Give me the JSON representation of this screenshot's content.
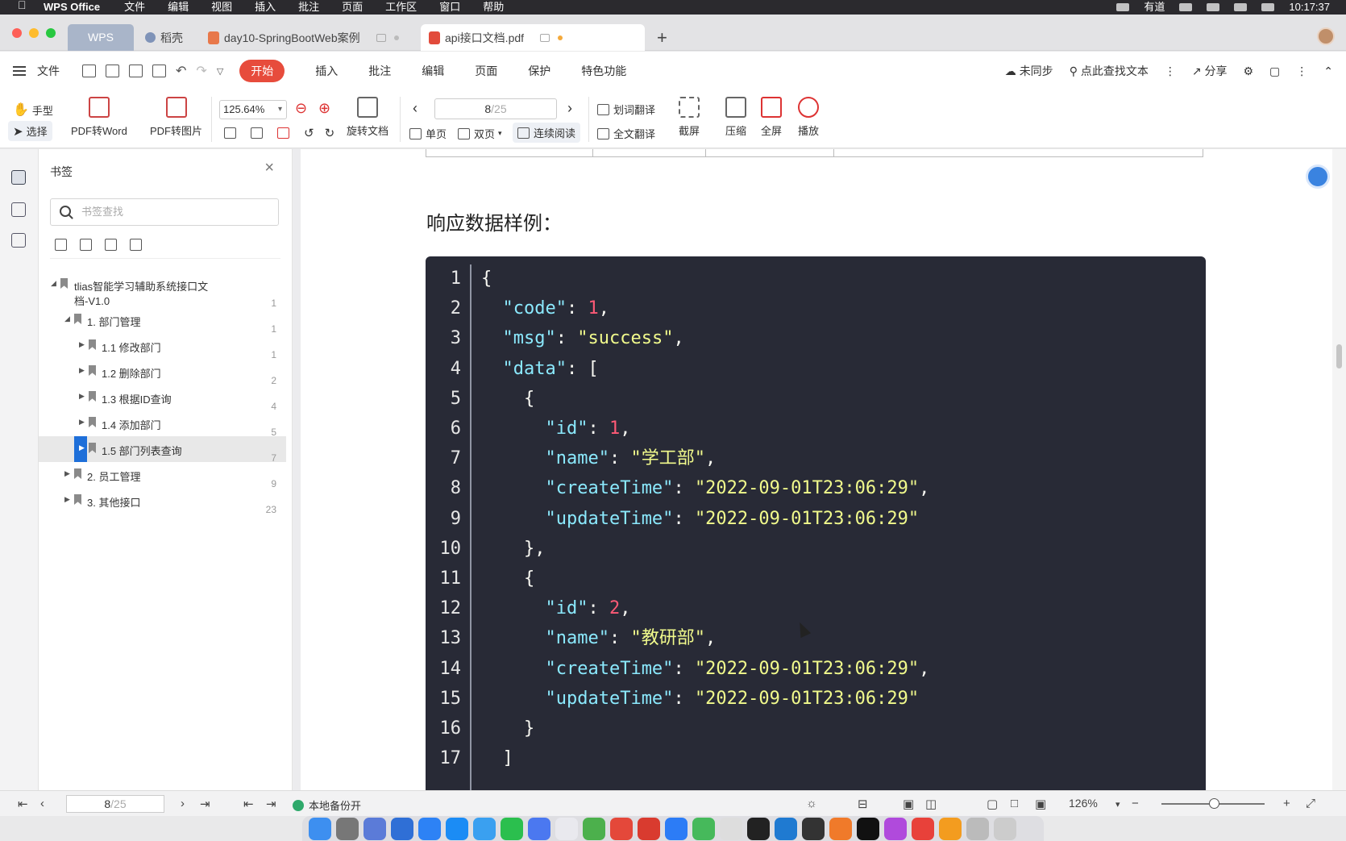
{
  "menubar": {
    "app_name": "WPS Office",
    "items": [
      "文件",
      "编辑",
      "视图",
      "插入",
      "批注",
      "页面",
      "工作区",
      "窗口",
      "帮助"
    ],
    "status_app": "有道",
    "time": "10:17:37"
  },
  "tabs": {
    "home_label": "WPS",
    "items": [
      {
        "label": "稻壳",
        "icon": "daoke-icon"
      },
      {
        "label": "day10-SpringBootWeb案例",
        "icon": "ppt-file-icon"
      },
      {
        "label": "api接口文档.pdf",
        "icon": "pdf-file-icon"
      }
    ],
    "new_tab": "+"
  },
  "menu": {
    "file": "文件",
    "start": "开始",
    "items": [
      "插入",
      "批注",
      "编辑",
      "页面",
      "保护",
      "特色功能"
    ],
    "sync": "未同步",
    "find": "点此查找文本",
    "share": "分享"
  },
  "toolbar": {
    "hand": "手型",
    "select": "选择",
    "pdf_to_word": "PDF转Word",
    "pdf_to_image": "PDF转图片",
    "zoom": "125.64%",
    "rotate_doc": "旋转文档",
    "page_current": "8",
    "page_total": "/25",
    "single_page": "单页",
    "double_page": "双页",
    "continuous": "连续阅读",
    "word_translate": "划词翻译",
    "full_translate": "全文翻译",
    "screenshot": "截屏",
    "compress": "压缩",
    "fullscreen": "全屏",
    "play": "播放"
  },
  "bookmarks": {
    "title": "书签",
    "search_placeholder": "书签查找",
    "items": [
      {
        "label": "tlias智能学习辅助系统接口文",
        "label2": "档-V1.0",
        "page": "1",
        "level": 0,
        "expanded": true
      },
      {
        "label": "1. 部门管理",
        "page": "1",
        "level": 1,
        "expanded": true
      },
      {
        "label": "1.1 修改部门",
        "page": "1",
        "level": 2
      },
      {
        "label": "1.2 删除部门",
        "page": "2",
        "level": 2
      },
      {
        "label": "1.3 根据ID查询",
        "page": "4",
        "level": 2
      },
      {
        "label": "1.4 添加部门",
        "page": "5",
        "level": 2
      },
      {
        "label": "1.5 部门列表查询",
        "page": "7",
        "level": 2,
        "selected": true
      },
      {
        "label": "2. 员工管理",
        "page": "9",
        "level": 1
      },
      {
        "label": "3. 其他接口",
        "page": "23",
        "level": 1
      }
    ]
  },
  "document": {
    "heading": "响应数据样例：",
    "code_lines": [
      {
        "n": "1",
        "t": "{"
      },
      {
        "n": "2",
        "t": "  \"code\": 1,"
      },
      {
        "n": "3",
        "t": "  \"msg\": \"success\","
      },
      {
        "n": "4",
        "t": "  \"data\": ["
      },
      {
        "n": "5",
        "t": "    {"
      },
      {
        "n": "6",
        "t": "      \"id\": 1,"
      },
      {
        "n": "7",
        "t": "      \"name\": \"学工部\","
      },
      {
        "n": "8",
        "t": "      \"createTime\": \"2022-09-01T23:06:29\","
      },
      {
        "n": "9",
        "t": "      \"updateTime\": \"2022-09-01T23:06:29\""
      },
      {
        "n": "10",
        "t": "    },"
      },
      {
        "n": "11",
        "t": "    {"
      },
      {
        "n": "12",
        "t": "      \"id\": 2,"
      },
      {
        "n": "13",
        "t": "      \"name\": \"教研部\","
      },
      {
        "n": "14",
        "t": "      \"createTime\": \"2022-09-01T23:06:29\","
      },
      {
        "n": "15",
        "t": "      \"updateTime\": \"2022-09-01T23:06:29\""
      },
      {
        "n": "16",
        "t": "    }"
      },
      {
        "n": "17",
        "t": "  ]"
      }
    ]
  },
  "status": {
    "page_current": "8",
    "page_total": "/25",
    "backup": "本地备份开",
    "zoom": "126%"
  },
  "colors": {
    "accent_red": "#e74c3c",
    "code_bg": "#282a36",
    "selection_blue": "#1e6fd9"
  }
}
